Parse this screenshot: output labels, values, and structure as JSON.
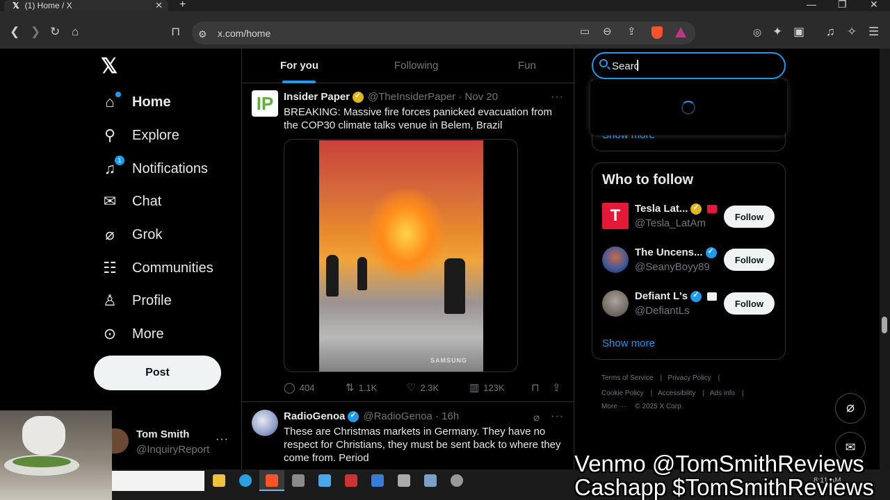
{
  "browser": {
    "tab_title": "(1) Home / X",
    "url": "x.com/home"
  },
  "nav": {
    "items": [
      {
        "label": "Home",
        "icon": "home-icon"
      },
      {
        "label": "Explore",
        "icon": "search-icon"
      },
      {
        "label": "Notifications",
        "icon": "bell-icon",
        "badge": "1"
      },
      {
        "label": "Chat",
        "icon": "mail-icon"
      },
      {
        "label": "Grok",
        "icon": "grok-icon"
      },
      {
        "label": "Communities",
        "icon": "people-icon"
      },
      {
        "label": "Profile",
        "icon": "person-icon"
      },
      {
        "label": "More",
        "icon": "more-circle-icon"
      }
    ],
    "post_label": "Post",
    "account": {
      "name": "Tom Smith",
      "handle": "@InquiryReport"
    }
  },
  "feed": {
    "tabs": [
      "For you",
      "Following",
      "Fun"
    ],
    "tweets": [
      {
        "name": "Insider Paper",
        "handle": "@TheInsiderPaper",
        "date": "Nov 20",
        "text": "BREAKING: Massive fire forces panicked evacuation from the COP30 climate talks venue in Belem, Brazil",
        "media_watermark": "SAMSUNG",
        "replies": "404",
        "reposts": "1.1K",
        "likes": "2.3K",
        "views": "123K"
      },
      {
        "name": "RadioGenoa",
        "handle": "@RadioGenoa",
        "date": "16h",
        "text": "These are Christmas markets in Germany. They have no respect for Christians, they must be sent back to where they come from. Period"
      }
    ]
  },
  "search": {
    "placeholder": "Search",
    "value": "Searc"
  },
  "trends": {
    "show_more": "Show more"
  },
  "who_to_follow": {
    "title": "Who to follow",
    "accounts": [
      {
        "name": "Tesla Lat...",
        "handle": "@Tesla_LatAm",
        "button": "Follow"
      },
      {
        "name": "The Uncens...",
        "handle": "@SeanyBoyy89",
        "button": "Follow"
      },
      {
        "name": "Defiant L's",
        "handle": "@DefiantLs",
        "button": "Follow"
      }
    ],
    "show_more": "Show more"
  },
  "footer": {
    "links": [
      "Terms of Service",
      "Privacy Policy",
      "Cookie Policy",
      "Accessibility",
      "Ads info",
      "More ···",
      "© 2025 X Corp."
    ]
  },
  "taskbar": {
    "time": "8:11 AM"
  },
  "overlay": {
    "line1": "Venmo @TomSmithReviews",
    "line2": "Cashapp $TomSmithReviews"
  },
  "colors": {
    "accent": "#1d9bf0",
    "gold_check": "#e2b719",
    "background": "#000000"
  }
}
